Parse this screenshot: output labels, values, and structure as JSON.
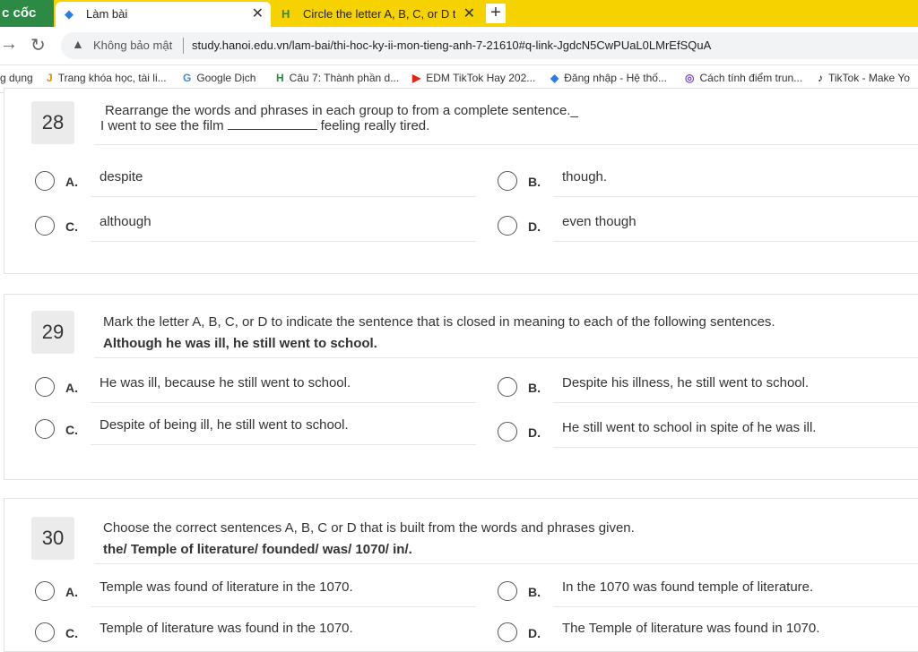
{
  "browser": {
    "brand": "c cốc",
    "tabs": [
      {
        "title": "Làm bài",
        "active": true
      },
      {
        "title": "Circle the letter A, B, C, or D t",
        "active": false
      }
    ],
    "new_tab": "+",
    "security": "Không bảo mật",
    "url": "study.hanoi.edu.vn/lam-bai/thi-hoc-ky-ii-mon-tieng-anh-7-21610#q-link-JgdcN5CwPUaL0LMrEfSQuA",
    "bookmarks": [
      "g dụng",
      "Trang khóa học, tài li...",
      "Google Dịch",
      "Câu 7: Thành phần d...",
      "EDM TikTok Hay 202...",
      "Đăng nhập - Hệ thố...",
      "Cách tính điểm trun...",
      "TikTok - Make Yo"
    ]
  },
  "questions": [
    {
      "number": "28",
      "prompt": "Rearrange the words and phrases in each group to from a complete sentence._",
      "sentence_before": "I went to see the film",
      "sentence_after": "feeling really tired.",
      "options": [
        {
          "letter": "A.",
          "text": "despite"
        },
        {
          "letter": "B.",
          "text": "though."
        },
        {
          "letter": "C.",
          "text": "although"
        },
        {
          "letter": "D.",
          "text": "even though"
        }
      ]
    },
    {
      "number": "29",
      "prompt": "Mark the letter A, B, C, or D to indicate the sentence that is closed in meaning to each of the following  sentences.",
      "sentence": "Although he was ill, he still went to school.",
      "options": [
        {
          "letter": "A.",
          "text": "He was ill, because he still went to school."
        },
        {
          "letter": "B.",
          "text": "Despite his illness, he still went to school."
        },
        {
          "letter": "C.",
          "text": "Despite of being ill, he still went to school."
        },
        {
          "letter": "D.",
          "text": "He still went to school in spite of he was ill."
        }
      ]
    },
    {
      "number": "30",
      "prompt": "Choose the correct sentences A, B, C or D that is built from the words and phrases given.",
      "sentence": "the/ Temple of literature/ founded/ was/ 1070/ in/.",
      "options": [
        {
          "letter": "A.",
          "text": "Temple was found  of literature in the 1070."
        },
        {
          "letter": "B.",
          "text": "In the 1070 was found temple of literature."
        },
        {
          "letter": "C.",
          "text": "Temple of literature was found in the 1070."
        },
        {
          "letter": "D.",
          "text": "The Temple of literature was found in 1070."
        }
      ]
    }
  ]
}
